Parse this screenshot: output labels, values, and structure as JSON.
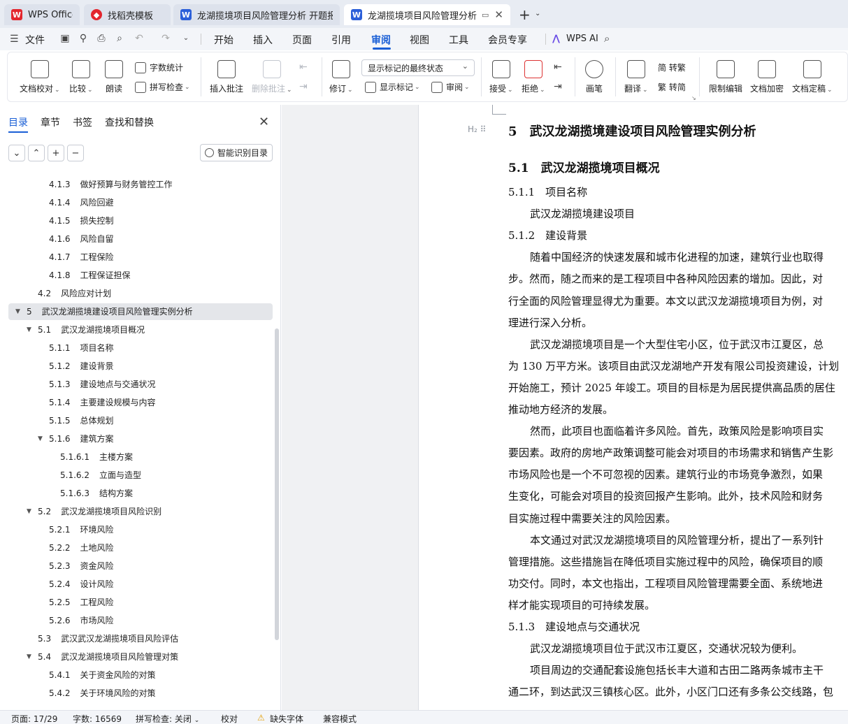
{
  "tabs": [
    {
      "label": "WPS Office",
      "icon": "wps-logo-icon"
    },
    {
      "label": "找稻壳模板",
      "icon": "docer-icon"
    },
    {
      "label": "龙湖揽境项目风险管理分析 开题报告",
      "icon": "word-doc-icon"
    },
    {
      "label": "龙湖揽境项目风险管理分析 毕",
      "icon": "word-doc-icon"
    }
  ],
  "menu": {
    "file": "文件",
    "items": [
      "开始",
      "插入",
      "页面",
      "引用",
      "审阅",
      "视图",
      "工具",
      "会员专享"
    ],
    "active": "审阅",
    "wps_ai": "WPS AI"
  },
  "ribbon": {
    "doc_check": "文档校对",
    "compare": "比较",
    "read_aloud": "朗读",
    "word_count": "字数统计",
    "spell_check": "拼写检查",
    "insert_comment": "插入批注",
    "delete_comment": "删除批注",
    "track_changes": "修订",
    "markup_dropdown": "显示标记的最终状态",
    "show_markup": "显示标记",
    "review_pane": "审阅",
    "accept": "接受",
    "reject": "拒绝",
    "pen": "画笔",
    "translate": "翻译",
    "to_traditional": "简 转繁",
    "to_simplified": "繁 转简",
    "restrict_edit": "限制编辑",
    "encrypt": "文档加密",
    "finalize": "文档定稿"
  },
  "nav": {
    "tabs": [
      "目录",
      "章节",
      "书签",
      "查找和替换"
    ],
    "smart_toc": "智能识别目录",
    "toc": [
      {
        "num": "4.1.3",
        "text": "做好预算与财务管控工作",
        "level": 3
      },
      {
        "num": "4.1.4",
        "text": "风险回避",
        "level": 3
      },
      {
        "num": "4.1.5",
        "text": "损失控制",
        "level": 3
      },
      {
        "num": "4.1.6",
        "text": "风险自留",
        "level": 3
      },
      {
        "num": "4.1.7",
        "text": "工程保险",
        "level": 3
      },
      {
        "num": "4.1.8",
        "text": "工程保证担保",
        "level": 3
      },
      {
        "num": "4.2",
        "text": "风险应对计划",
        "level": 2
      },
      {
        "num": "5",
        "text": "武汉龙湖揽境建设项目风险管理实例分析",
        "level": 1,
        "expanded": true,
        "selected": true
      },
      {
        "num": "5.1",
        "text": "武汉龙湖揽境项目概况",
        "level": 2,
        "expanded": true
      },
      {
        "num": "5.1.1",
        "text": "项目名称",
        "level": 3
      },
      {
        "num": "5.1.2",
        "text": "建设背景",
        "level": 3
      },
      {
        "num": "5.1.3",
        "text": "建设地点与交通状况",
        "level": 3
      },
      {
        "num": "5.1.4",
        "text": "主要建设规模与内容",
        "level": 3
      },
      {
        "num": "5.1.5",
        "text": "总体规划",
        "level": 3
      },
      {
        "num": "5.1.6",
        "text": "建筑方案",
        "level": 3,
        "expanded": true
      },
      {
        "num": "5.1.6.1",
        "text": "主楼方案",
        "level": 4
      },
      {
        "num": "5.1.6.2",
        "text": "立面与造型",
        "level": 4
      },
      {
        "num": "5.1.6.3",
        "text": "结构方案",
        "level": 4
      },
      {
        "num": "5.2",
        "text": "武汉龙湖揽境项目风险识别",
        "level": 2,
        "expanded": true
      },
      {
        "num": "5.2.1",
        "text": "环境风险",
        "level": 3
      },
      {
        "num": "5.2.2",
        "text": "土地风险",
        "level": 3
      },
      {
        "num": "5.2.3",
        "text": "资金风险",
        "level": 3
      },
      {
        "num": "5.2.4",
        "text": "设计风险",
        "level": 3
      },
      {
        "num": "5.2.5",
        "text": "工程风险",
        "level": 3
      },
      {
        "num": "5.2.6",
        "text": "市场风险",
        "level": 3
      },
      {
        "num": "5.3",
        "text": "武汉武汉龙湖揽境项目风险评估",
        "level": 2
      },
      {
        "num": "5.4",
        "text": "武汉龙湖揽境项目风险管理对策",
        "level": 2,
        "expanded": true
      },
      {
        "num": "5.4.1",
        "text": "关于资金风险的对策",
        "level": 3
      },
      {
        "num": "5.4.2",
        "text": "关于环境风险的对策",
        "level": 3
      }
    ]
  },
  "document": {
    "h1": "5　武汉龙湖揽境建设项目风险管理实例分析",
    "h2": "5.1　武汉龙湖揽境项目概况",
    "lines": [
      {
        "type": "h3",
        "text": "5.1.1　项目名称"
      },
      {
        "type": "p",
        "text": "武汉龙湖揽境建设项目",
        "indent": true
      },
      {
        "type": "h3",
        "text": "5.1.2　建设背景"
      },
      {
        "type": "p",
        "text": "随着中国经济的快速发展和城市化进程的加速，建筑行业也取得",
        "indent": true
      },
      {
        "type": "p",
        "text": "步。然而，随之而来的是工程项目中各种风险因素的增加。因此，对"
      },
      {
        "type": "p",
        "text": "行全面的风险管理显得尤为重要。本文以武汉龙湖揽境项目为例，对"
      },
      {
        "type": "p",
        "text": "理进行深入分析。"
      },
      {
        "type": "p",
        "text": "武汉龙湖揽境项目是一个大型住宅小区，位于武汉市江夏区，总",
        "indent": true
      },
      {
        "type": "p",
        "text": "为 130 万平方米。该项目由武汉龙湖地产开发有限公司投资建设，计划"
      },
      {
        "type": "p",
        "text": "开始施工，预计 2025 年竣工。项目的目标是为居民提供高品质的居住"
      },
      {
        "type": "p",
        "text": "推动地方经济的发展。"
      },
      {
        "type": "p",
        "text": "然而，此项目也面临着许多风险。首先，政策风险是影响项目实",
        "indent": true
      },
      {
        "type": "p",
        "text": "要因素。政府的房地产政策调整可能会对项目的市场需求和销售产生影"
      },
      {
        "type": "p",
        "text": "市场风险也是一个不可忽视的因素。建筑行业的市场竞争激烈，如果"
      },
      {
        "type": "p",
        "text": "生变化，可能会对项目的投资回报产生影响。此外，技术风险和财务"
      },
      {
        "type": "p",
        "text": "目实施过程中需要关注的风险因素。"
      },
      {
        "type": "p",
        "text": "本文通过对武汉龙湖揽境项目的风险管理分析，提出了一系列针",
        "indent": true
      },
      {
        "type": "p",
        "text": "管理措施。这些措施旨在降低项目实施过程中的风险，确保项目的顺"
      },
      {
        "type": "p",
        "text": "功交付。同时，本文也指出，工程项目风险管理需要全面、系统地进"
      },
      {
        "type": "p",
        "text": "样才能实现项目的可持续发展。"
      },
      {
        "type": "h3",
        "text": "5.1.3　建设地点与交通状况"
      },
      {
        "type": "p",
        "text": "武汉龙湖揽境项目位于武汉市江夏区，交通状况较为便利。",
        "indent": true
      },
      {
        "type": "p",
        "text": "项目周边的交通配套设施包括长丰大道和古田二路两条城市主干",
        "indent": true
      },
      {
        "type": "p",
        "text": "通二环，到达武汉三镇核心区。此外，小区门口还有多条公交线路，包"
      }
    ]
  },
  "status": {
    "page": "页面: 17/29",
    "words": "字数: 16569",
    "spell": "拼写检查: 关闭",
    "proof": "校对",
    "missing_font": "缺失字体",
    "compat": "兼容模式"
  },
  "colors": {
    "accent": "#1a5fd6",
    "wps_red": "#e3262e",
    "word_blue": "#2b5fd9"
  }
}
